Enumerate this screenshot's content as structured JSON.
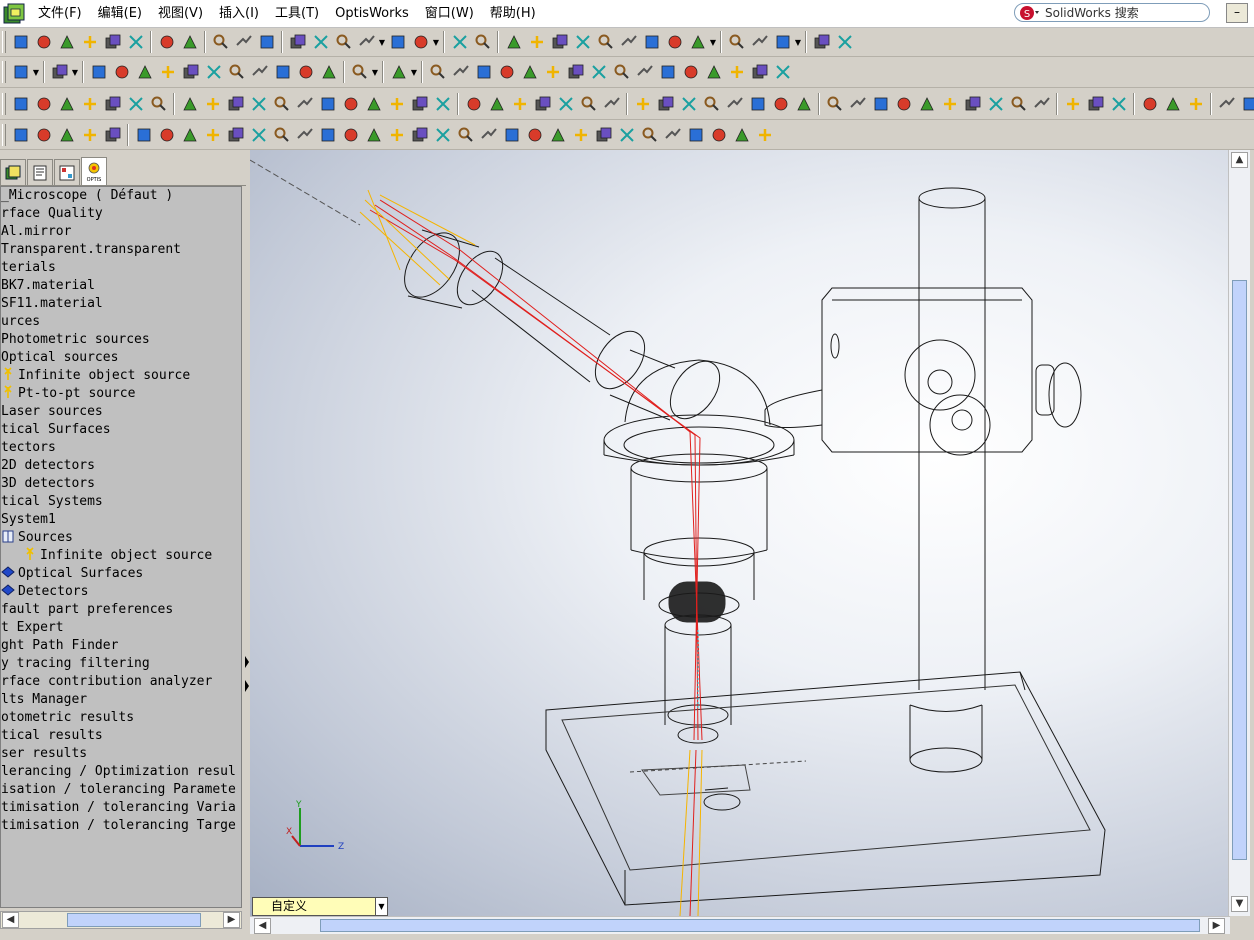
{
  "menubar": {
    "items": [
      "文件(F)",
      "编辑(E)",
      "视图(V)",
      "插入(I)",
      "工具(T)",
      "OptisWorks",
      "窗口(W)",
      "帮助(H)"
    ],
    "search_placeholder": "SolidWorks 搜索"
  },
  "tree": {
    "rows": [
      {
        "text": "_Microscope ( Défaut )",
        "indent": 0,
        "icon": "none"
      },
      {
        "text": "rface Quality",
        "indent": 0,
        "icon": "none"
      },
      {
        "text": " Al.mirror",
        "indent": 0,
        "icon": "none"
      },
      {
        "text": " Transparent.transparent",
        "indent": 0,
        "icon": "none"
      },
      {
        "text": "terials",
        "indent": 0,
        "icon": "none"
      },
      {
        "text": " BK7.material",
        "indent": 0,
        "icon": "none"
      },
      {
        "text": " SF11.material",
        "indent": 0,
        "icon": "none"
      },
      {
        "text": "urces",
        "indent": 0,
        "icon": "none"
      },
      {
        "text": " Photometric sources",
        "indent": 0,
        "icon": "none"
      },
      {
        "text": " Optical sources",
        "indent": 0,
        "icon": "none"
      },
      {
        "text": "Infinite object source",
        "indent": 1,
        "icon": "source-arrow"
      },
      {
        "text": "Pt-to-pt source",
        "indent": 1,
        "icon": "source-arrow"
      },
      {
        "text": " Laser sources",
        "indent": 0,
        "icon": "none"
      },
      {
        "text": "tical Surfaces",
        "indent": 0,
        "icon": "none"
      },
      {
        "text": "tectors",
        "indent": 0,
        "icon": "none"
      },
      {
        "text": " 2D detectors",
        "indent": 0,
        "icon": "none"
      },
      {
        "text": " 3D detectors",
        "indent": 0,
        "icon": "none"
      },
      {
        "text": "tical Systems",
        "indent": 0,
        "icon": "none"
      },
      {
        "text": " System1",
        "indent": 0,
        "icon": "none"
      },
      {
        "text": "Sources",
        "indent": 0,
        "icon": "book"
      },
      {
        "text": "Infinite object source",
        "indent": 2,
        "icon": "source-arrow"
      },
      {
        "text": "Optical Surfaces",
        "indent": 0,
        "icon": "blue-book"
      },
      {
        "text": "Detectors",
        "indent": 0,
        "icon": "blue-book"
      },
      {
        "text": "fault part preferences",
        "indent": 0,
        "icon": "none"
      },
      {
        "text": "t Expert",
        "indent": 0,
        "icon": "none"
      },
      {
        "text": "ght Path Finder",
        "indent": 0,
        "icon": "none"
      },
      {
        "text": "y tracing filtering",
        "indent": 0,
        "icon": "none"
      },
      {
        "text": "rface contribution analyzer",
        "indent": 0,
        "icon": "none"
      },
      {
        "text": "lts Manager",
        "indent": 0,
        "icon": "none"
      },
      {
        "text": "otometric results",
        "indent": 0,
        "icon": "none"
      },
      {
        "text": "tical results",
        "indent": 0,
        "icon": "none"
      },
      {
        "text": "ser results",
        "indent": 0,
        "icon": "none"
      },
      {
        "text": "lerancing / Optimization resul",
        "indent": 0,
        "icon": "none"
      },
      {
        "text": "isation / tolerancing Paramete",
        "indent": 0,
        "icon": "none"
      },
      {
        "text": "timisation / tolerancing Varia",
        "indent": 0,
        "icon": "none"
      },
      {
        "text": "timisation / tolerancing Targe",
        "indent": 0,
        "icon": "none"
      }
    ]
  },
  "panel_tabs": [
    "feature-manager-tab",
    "property-manager-tab",
    "configuration-manager-tab",
    "optis-tab"
  ],
  "optis_tab_label": "OPTIS",
  "view": {
    "orientation_value": "自定义",
    "triad": {
      "x_label": "X",
      "y_label": "Y",
      "z_label": "Z"
    }
  },
  "colors": {
    "ray_red": "#e0201e",
    "ray_yellow": "#f5b400",
    "ray_cyan": "#20c8d8",
    "wireframe": "#1a1a1a"
  }
}
